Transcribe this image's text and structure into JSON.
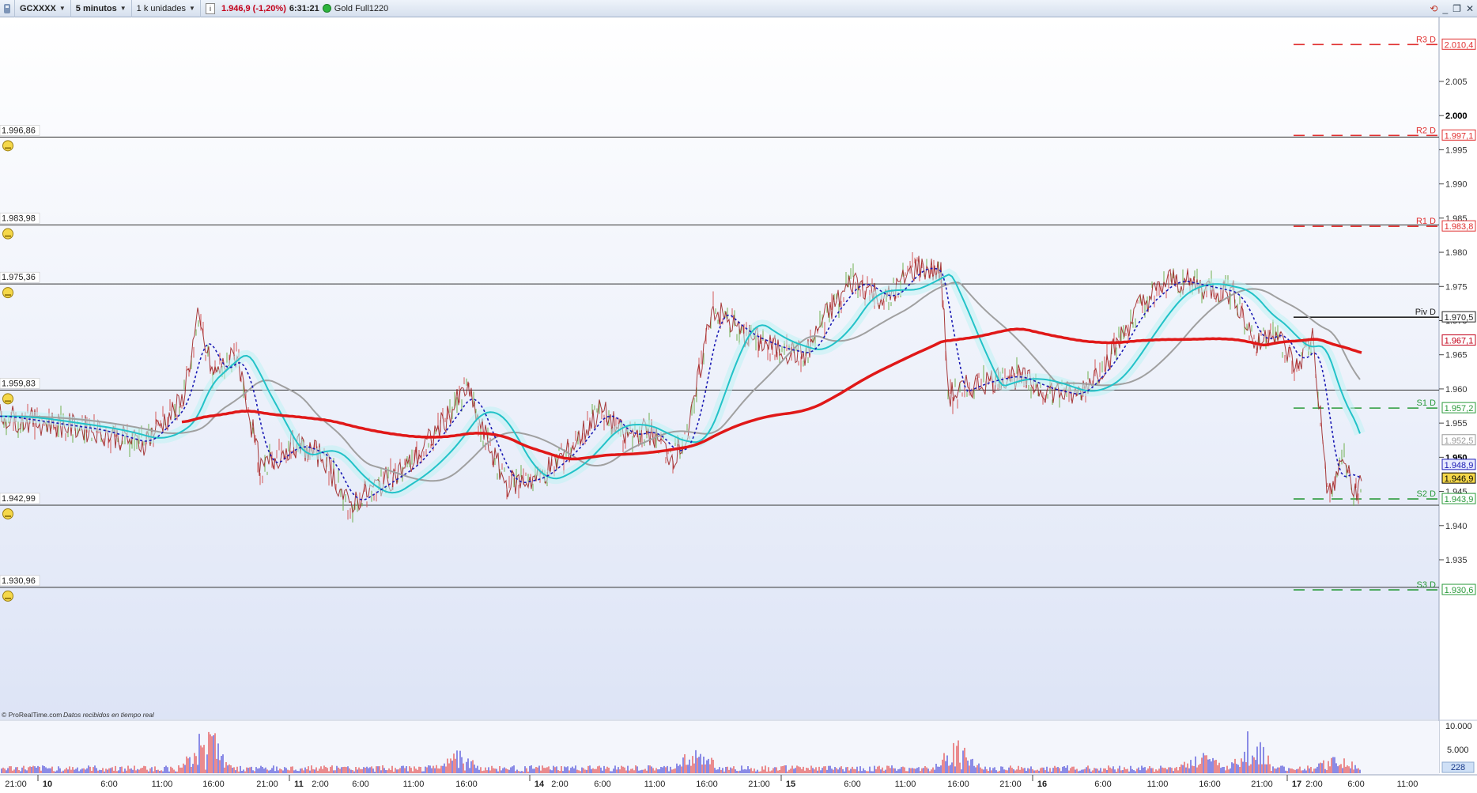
{
  "toolbar": {
    "instrument": "GCXXXX",
    "timeframe": "5 minutos",
    "units": "1 k unidades",
    "info_icon": "info-icon",
    "price": "1.946,9",
    "change": "(-1,20%)",
    "time": "6:31:21",
    "status_color": "#2db43d",
    "feed": "Gold Full1220"
  },
  "window_controls": [
    "refresh-icon",
    "minimize-icon",
    "restore-icon",
    "close-icon"
  ],
  "colors": {
    "ma_red": "#e01818",
    "ma_cyan": "#22c2c8",
    "ma_gray": "#a0a0a0",
    "dotted_blue": "#1a1ab4",
    "price_line": "#9a1a1a",
    "pivot_red": "#e03030",
    "pivot_green": "#2a9a3a"
  },
  "chart": {
    "price_axis_ticks": [
      "2.005",
      "2.000",
      "1.995",
      "1.990",
      "1.985",
      "1.980",
      "1.975",
      "1.970",
      "1.965",
      "1.960",
      "1.955",
      "1.950",
      "1.945",
      "1.940",
      "1.935"
    ],
    "alert_levels": [
      "1.996,86",
      "1.983,98",
      "1.975,36",
      "1.959,83",
      "1.942,99",
      "1.930,96"
    ],
    "pivots": [
      {
        "label": "R3 D",
        "value": "2.010,4",
        "kind": "resistance"
      },
      {
        "label": "R2 D",
        "value": "1.997,1",
        "kind": "resistance"
      },
      {
        "label": "R1 D",
        "value": "1.983,8",
        "kind": "resistance"
      },
      {
        "label": "Piv D",
        "value": "1.970,5",
        "kind": "pivot"
      },
      {
        "label": "S1 D",
        "value": "1.957,2",
        "kind": "support"
      },
      {
        "label": "S2 D",
        "value": "1.943,9",
        "kind": "support"
      },
      {
        "label": "S3 D",
        "value": "1.930,6",
        "kind": "support"
      }
    ],
    "axis_tags": {
      "red_ma": "1.967,1",
      "gray_ma": "1.952,5",
      "blue_dotted": "1.948,9",
      "last_price": "1.946,9",
      "bold_tick": "1.950"
    },
    "time_labels": [
      "21:00",
      "10",
      "6:00",
      "11:00",
      "16:00",
      "21:00",
      "11",
      "2:00",
      "6:00",
      "11:00",
      "16:00",
      "14",
      "2:00",
      "6:00",
      "11:00",
      "16:00",
      "21:00",
      "15",
      "6:00",
      "11:00",
      "16:00",
      "21:00",
      "16",
      "6:00",
      "11:00",
      "16:00",
      "21:00",
      "17",
      "2:00",
      "6:00",
      "11:00"
    ],
    "copyright": "© ProRealTime.com",
    "realtime_note": "Datos recibidos en tiempo real",
    "volume_ticks": [
      "10.000",
      "5.000"
    ],
    "volume_last": "228"
  }
}
